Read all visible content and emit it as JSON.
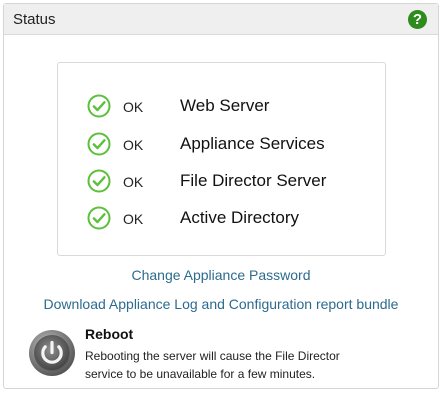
{
  "panel": {
    "title": "Status",
    "help_icon": "help-icon",
    "help_glyph": "?"
  },
  "status": {
    "items": [
      {
        "state": "OK",
        "name": "Web Server",
        "icon": "check-circle-icon"
      },
      {
        "state": "OK",
        "name": "Appliance Services",
        "icon": "check-circle-icon"
      },
      {
        "state": "OK",
        "name": "File Director Server",
        "icon": "check-circle-icon"
      },
      {
        "state": "OK",
        "name": "Active Directory",
        "icon": "check-circle-icon"
      }
    ],
    "ok_color": "#5cc03c"
  },
  "links": {
    "change_password": "Change Appliance Password",
    "download_log": "Download Appliance Log and Configuration report bundle",
    "color": "#2c6b8e"
  },
  "reboot": {
    "title": "Reboot",
    "description": "Rebooting the server will cause the File Director service to be unavailable for a few minutes.",
    "icon": "power-icon"
  }
}
